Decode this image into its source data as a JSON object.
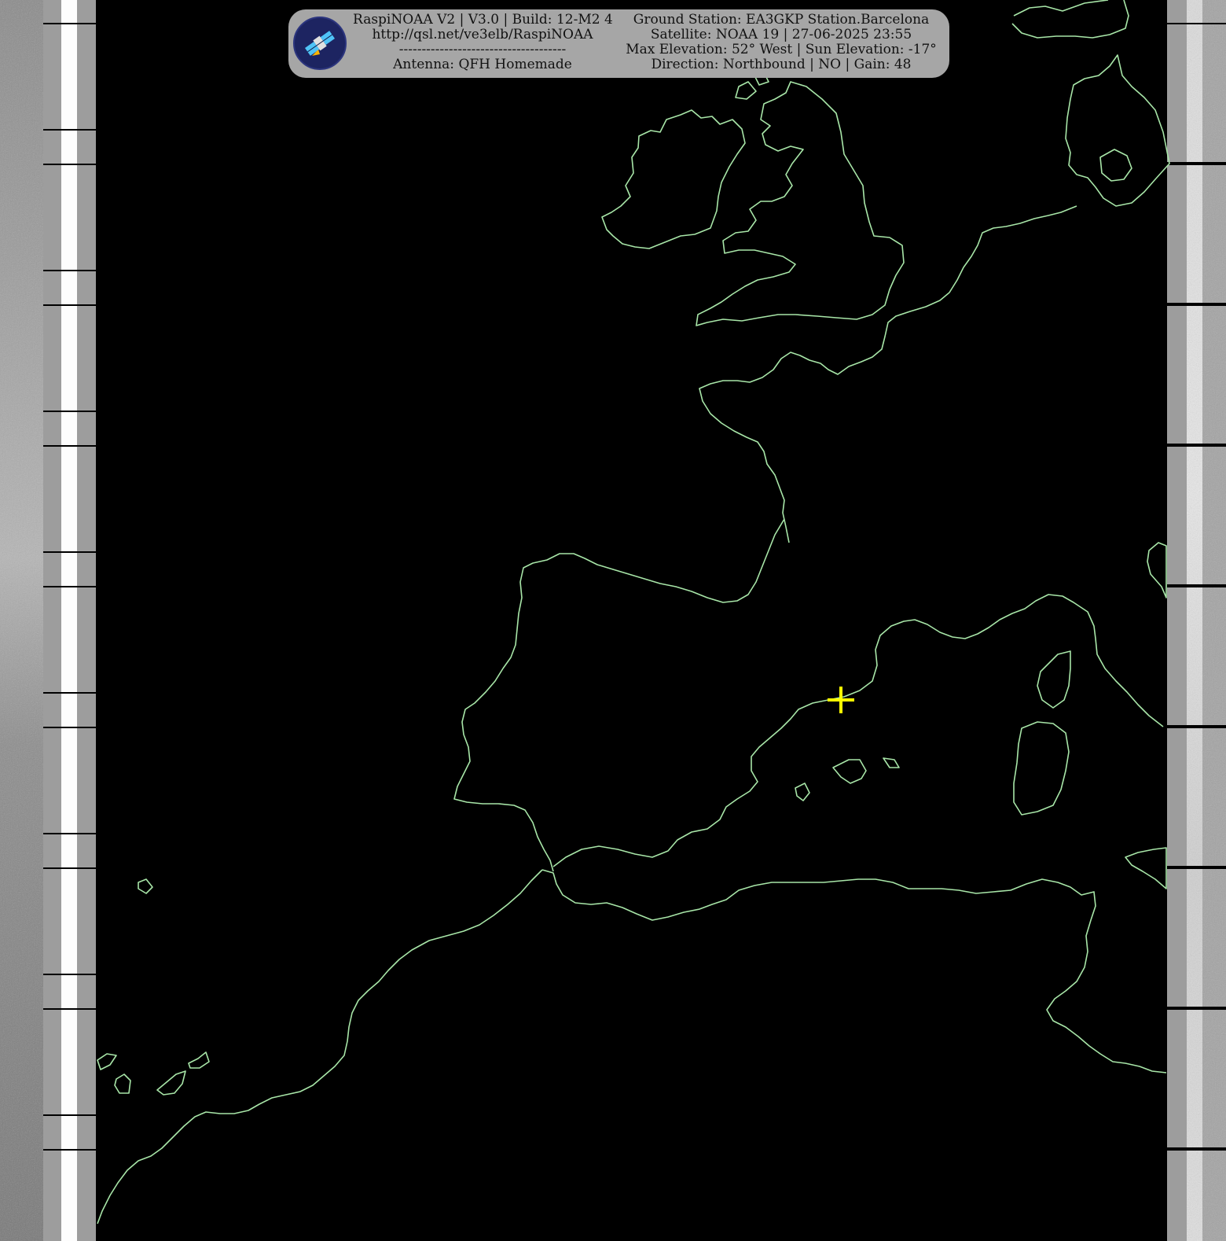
{
  "header": {
    "left_lines": [
      "RaspiNOAA V2 | V3.0 | Build: 12-M2 4",
      "http://qsl.net/ve3elb/RaspiNOAA",
      "-------------------------------------",
      "Antenna: QFH Homemade"
    ],
    "right_lines": [
      "Ground Station: EA3GKP Station.Barcelona",
      "Satellite: NOAA 19 | 27-06-2025 23:55",
      "Max Elevation: 52° West | Sun Elevation: -17°",
      "Direction: Northbound | NO | Gain: 48"
    ],
    "logo_icon": "satellite-icon"
  },
  "map": {
    "ground_station_marker": "crosshair-icon",
    "colors": {
      "coastline": "#a8e6a8",
      "marker": "#ffff00",
      "panel": "#a6a6a6",
      "background": "#000000"
    }
  }
}
